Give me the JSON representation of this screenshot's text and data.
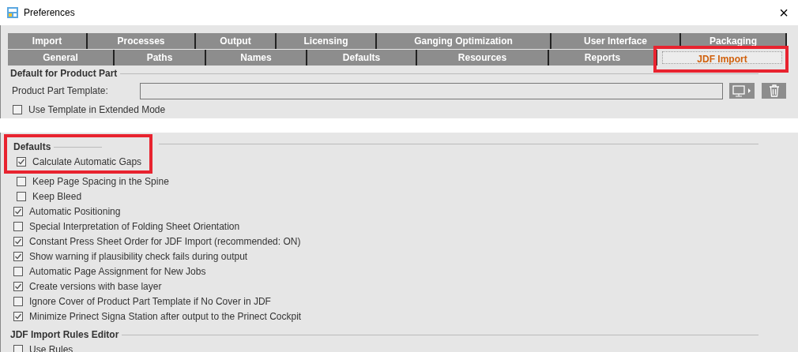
{
  "window": {
    "title": "Preferences",
    "close": "×"
  },
  "tab_rows": [
    {
      "tabs": [
        {
          "label": "Import",
          "selected": false,
          "highlighted": false
        },
        {
          "label": "Processes",
          "selected": false,
          "highlighted": false
        },
        {
          "label": "Output",
          "selected": false,
          "highlighted": false
        },
        {
          "label": "Licensing",
          "selected": false,
          "highlighted": false
        },
        {
          "label": "Ganging Optimization",
          "selected": false,
          "highlighted": false
        },
        {
          "label": "User Interface",
          "selected": false,
          "highlighted": false
        },
        {
          "label": "Packaging",
          "selected": false,
          "highlighted": false
        }
      ]
    },
    {
      "tabs": [
        {
          "label": "General",
          "selected": false,
          "highlighted": false
        },
        {
          "label": "Paths",
          "selected": false,
          "highlighted": false
        },
        {
          "label": "Names",
          "selected": false,
          "highlighted": false
        },
        {
          "label": "Defaults",
          "selected": false,
          "highlighted": false
        },
        {
          "label": "Resources",
          "selected": false,
          "highlighted": false
        },
        {
          "label": "Reports",
          "selected": false,
          "highlighted": false
        },
        {
          "label": "JDF Import",
          "selected": true,
          "highlighted": true
        }
      ]
    }
  ],
  "product_part": {
    "title": "Default for Product Part",
    "field_label": "Product Part Template:",
    "checkbox": {
      "label": "Use Template in Extended Mode",
      "checked": false
    }
  },
  "defaults": {
    "title": "Defaults",
    "highlighted": true,
    "options": [
      {
        "label": "Calculate Automatic Gaps",
        "checked": true,
        "children": [
          {
            "label": "Keep Page Spacing in the Spine",
            "checked": false
          },
          {
            "label": "Keep Bleed",
            "checked": false
          }
        ]
      },
      {
        "label": "Automatic Positioning",
        "checked": true
      },
      {
        "label": "Special Interpretation of Folding Sheet Orientation",
        "checked": false
      },
      {
        "label": "Constant Press Sheet Order for JDF Import (recommended: ON)",
        "checked": true
      },
      {
        "label": "Show warning if plausibility check fails during output",
        "checked": true
      },
      {
        "label": "Automatic Page Assignment for New Jobs",
        "checked": false
      },
      {
        "label": "Create versions with base layer",
        "checked": true
      },
      {
        "label": "Ignore Cover of Product Part Template if No Cover in JDF",
        "checked": false
      },
      {
        "label": "Minimize Prinect Signa Station after output to the Prinect Cockpit",
        "checked": true
      }
    ]
  },
  "rules_editor": {
    "title": "JDF Import Rules Editor",
    "options": [
      {
        "label": "Use Rules",
        "checked": false
      }
    ]
  }
}
